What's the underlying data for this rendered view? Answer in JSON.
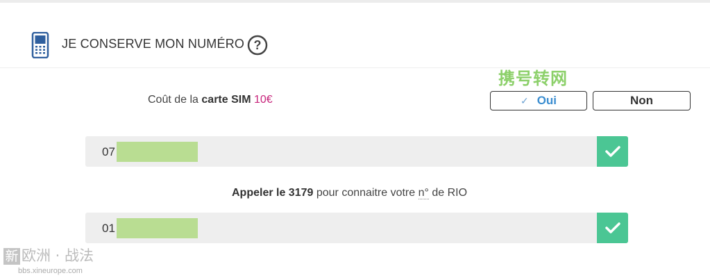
{
  "section": {
    "title": "JE CONSERVE MON NUMÉRO",
    "icon": "mobile-phone-icon",
    "help_icon": "question-mark-icon",
    "help_glyph": "?"
  },
  "watermark_top": "携号转网",
  "sim": {
    "label_prefix": "Coût de la",
    "label_bold": "carte SIM",
    "price": "10€",
    "price_color": "#c8267c"
  },
  "choice": {
    "selected": "Oui",
    "yes_check": "✓",
    "yes_label": "Oui",
    "no_label": "Non",
    "yes_color": "#3a8dd0"
  },
  "phone_number": {
    "value_prefix": "07",
    "status_icon": "check-icon",
    "status_color": "#4bc694"
  },
  "rio_hint": {
    "bold": "Appeler le 3179",
    "text": " pour connaitre votre ",
    "abbr": "n°",
    "suffix": " de RIO"
  },
  "rio_field": {
    "value_prefix": "01",
    "status_icon": "check-icon"
  },
  "watermark_bottom": {
    "logo_char": "新",
    "logo_text": "欧洲 · 战法",
    "url": "bbs.xineurope.com"
  }
}
